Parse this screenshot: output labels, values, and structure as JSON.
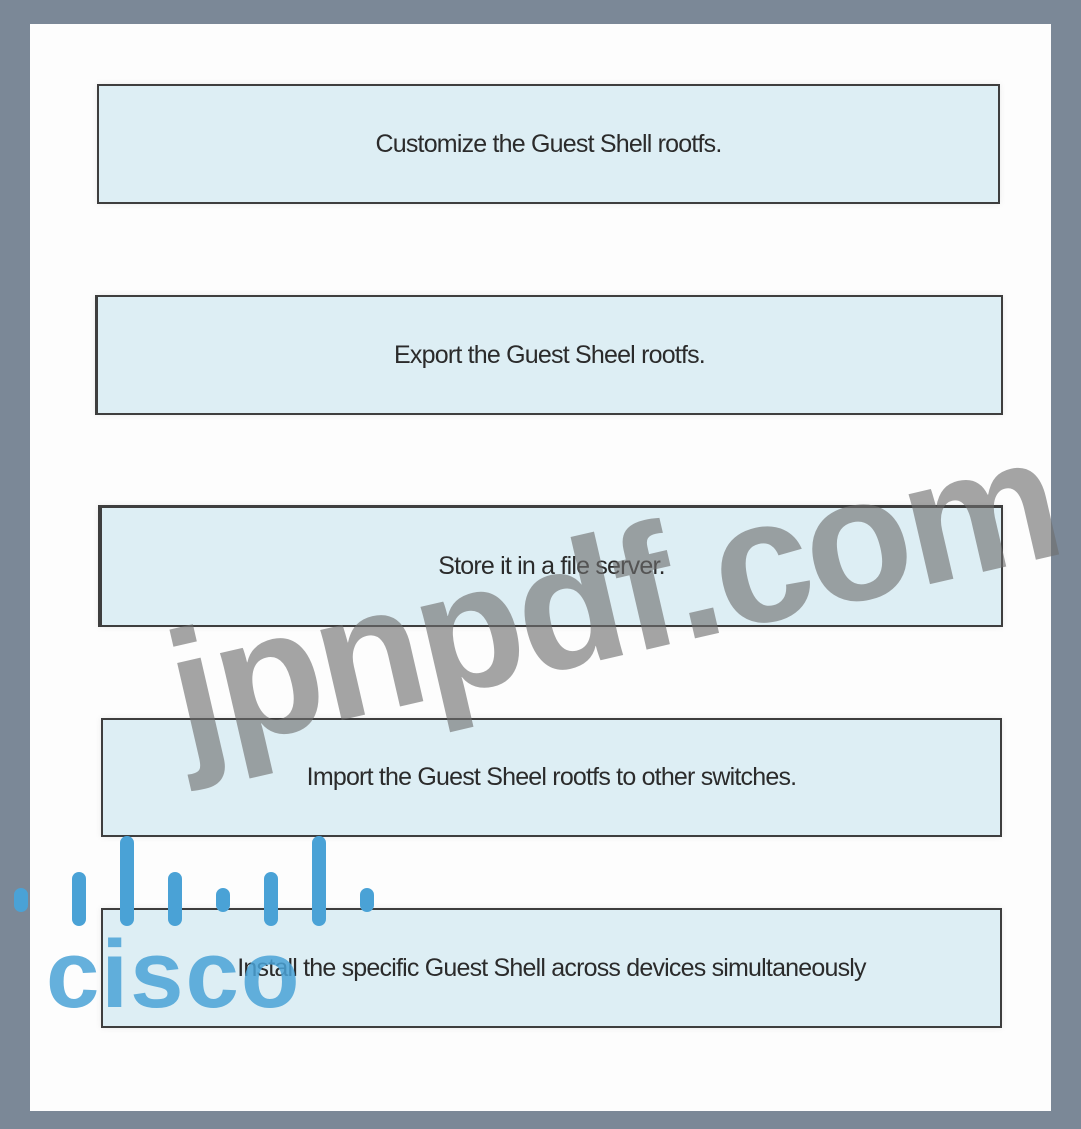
{
  "steps": [
    {
      "label": "Customize the Guest Shell rootfs."
    },
    {
      "label": "Export the Guest Sheel rootfs."
    },
    {
      "label": "Store it in a file server."
    },
    {
      "label": "Import the Guest Sheel rootfs to other switches."
    },
    {
      "label": "Install the specific Guest Shell across devices simultaneously"
    }
  ],
  "watermark": {
    "text": "jpnpdf.com",
    "color": "#6e6e6e"
  },
  "logo": {
    "text": "cisco",
    "color": "#4aa2d6"
  },
  "colors": {
    "frame": "#7b8897",
    "box_fill": "#ddeef4",
    "box_border": "#3e3e3e"
  }
}
